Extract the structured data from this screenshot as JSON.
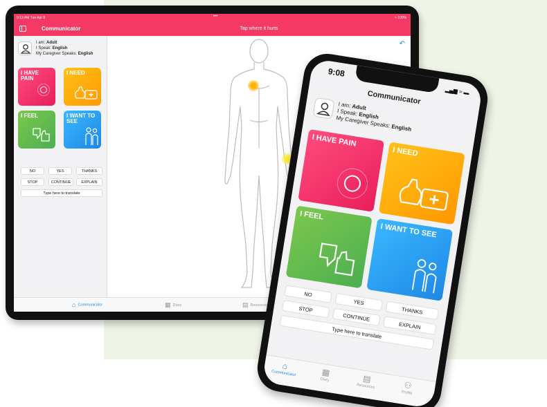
{
  "tablet": {
    "status": {
      "time": "9:13 AM  Tue Apr 8",
      "dots": "•••",
      "battery": "100%"
    },
    "header": {
      "title": "Communicator",
      "hint": "Tap where it hurts"
    },
    "user": {
      "i_am_label": "I am: ",
      "i_am": "Adult",
      "speak_label": "I Speak: ",
      "speak": "English",
      "caregiver_label": "My Caregiver Speaks: ",
      "caregiver": "English"
    },
    "tiles": {
      "pain": "I HAVE PAIN",
      "need": "I NEED",
      "feel": "I FEEL",
      "see": "I WANT TO SEE"
    },
    "buttons": {
      "no": "NO",
      "yes": "YES",
      "thanks": "THANKS",
      "stop": "STOP",
      "continue": "CONTINUE",
      "explain": "EXPLAIN"
    },
    "translate": "Type here to translate",
    "tabs": {
      "communicator": "Communicator",
      "diary": "Diary",
      "resources": "Resources"
    },
    "pain_points_count": 2
  },
  "phone": {
    "time": "9:08",
    "title": "Communicator",
    "user": {
      "i_am_label": "I am: ",
      "i_am": "Adult",
      "speak_label": "I Speak: ",
      "speak": "English",
      "caregiver_label": "My Caregiver Speaks: ",
      "caregiver": "English"
    },
    "tiles": {
      "pain": "I HAVE PAIN",
      "need": "I NEED",
      "feel": "I FEEL",
      "see": "I WANT TO SEE"
    },
    "buttons": {
      "no": "NO",
      "yes": "YES",
      "thanks": "THANKS",
      "stop": "STOP",
      "continue": "CONTINUE",
      "explain": "EXPLAIN"
    },
    "translate": "Type here to translate",
    "tabs": {
      "communicator": "Communicator",
      "diary": "Diary",
      "resources": "Resources",
      "profile": "Profile"
    }
  },
  "colors": {
    "brand": "#f43a64",
    "pain": "#e91e5a",
    "need": "#ff9800",
    "feel": "#4caf50",
    "see": "#1e88e5",
    "background_panel": "#eef4e6"
  }
}
